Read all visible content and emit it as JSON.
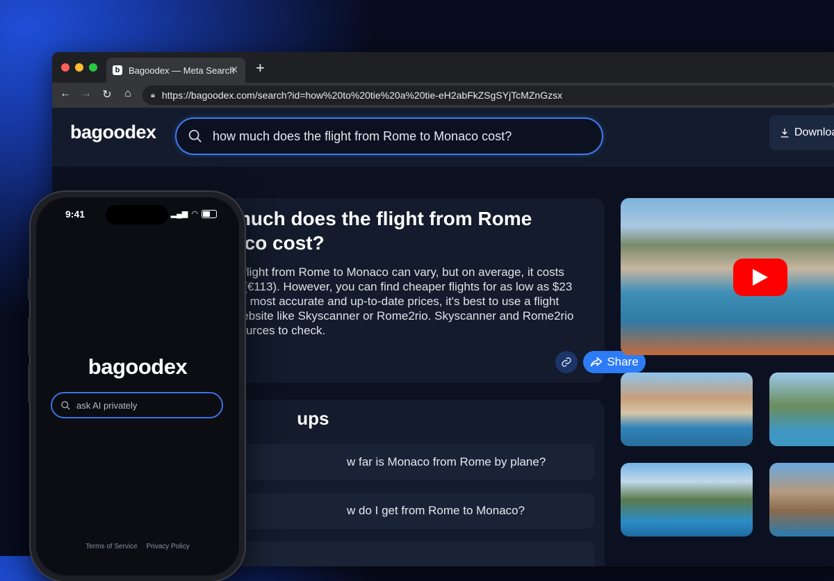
{
  "browser": {
    "tab_title": "Bagoodex — Meta Search",
    "favicon_letter": "b",
    "url": "https://bagoodex.com/search?id=how%20to%20tie%20a%20tie-eH2abFkZSgSYjTcMZnGzsx"
  },
  "header": {
    "logo": "bagoodex",
    "query": "how much does the flight from Rome to Monaco cost?",
    "download_label": "Download"
  },
  "answer": {
    "title": "much does the flight from Rome\naco cost?",
    "body": "a flight from Rome to Monaco can vary, but on average, it costs\n9 (€113). However, you can find cheaper flights for as low as $23\nhe most accurate and up-to-date prices, it's best to use a flight\n website like Skyscanner or Rome2rio. Skyscanner and Rome2rio\nsources to check.",
    "share_label": "Share"
  },
  "followups": {
    "title": " ups",
    "items": [
      "w far is Monaco from Rome by plane?",
      "w do I get from Rome to Monaco?"
    ]
  },
  "phone": {
    "time": "9:41",
    "logo": "bagoodex",
    "search_placeholder": "ask AI privately",
    "footer_terms": "Terms of Service",
    "footer_privacy": "Privacy Policy"
  },
  "colors": {
    "accent": "#2d7cf6",
    "background": "#0b1120",
    "youtube_red": "#ff0000"
  },
  "icons": [
    "search-icon",
    "download-icon",
    "link-icon",
    "share-icon",
    "play-icon",
    "lock-icon",
    "back-icon",
    "forward-icon",
    "reload-icon",
    "home-icon"
  ]
}
